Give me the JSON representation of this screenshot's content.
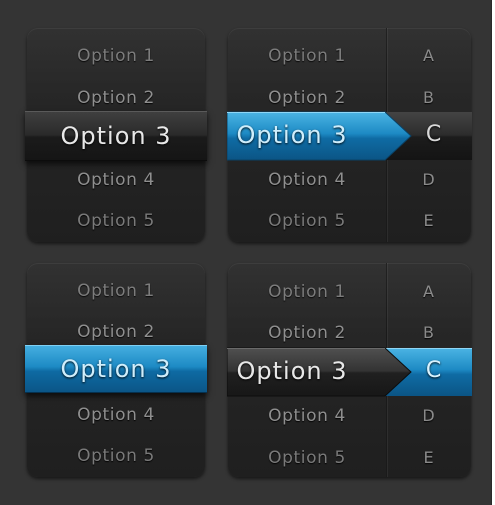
{
  "panels": [
    {
      "options": [
        "Option 1",
        "Option 2",
        "Option 3",
        "Option 4",
        "Option 5"
      ],
      "selected_index": 2,
      "selected_style": "dark"
    },
    {
      "options": [
        "Option 1",
        "Option 2",
        "Option 3",
        "Option 4",
        "Option 5"
      ],
      "letters": [
        "A",
        "B",
        "C",
        "D",
        "E"
      ],
      "selected_index": 2,
      "selected_style": "blue-arrow"
    },
    {
      "options": [
        "Option 1",
        "Option 2",
        "Option 3",
        "Option 4",
        "Option 5"
      ],
      "selected_index": 2,
      "selected_style": "blue"
    },
    {
      "options": [
        "Option 1",
        "Option 2",
        "Option 3",
        "Option 4",
        "Option 5"
      ],
      "letters": [
        "A",
        "B",
        "C",
        "D",
        "E"
      ],
      "selected_index": 2,
      "selected_style": "dark-arrow-blue-letter"
    }
  ],
  "colors": {
    "background": "#343434",
    "panel": "#262626",
    "accent_blue": "#1d8ac4",
    "selected_dark": "#2a2a2a",
    "option_text": "#8f8f8f"
  }
}
